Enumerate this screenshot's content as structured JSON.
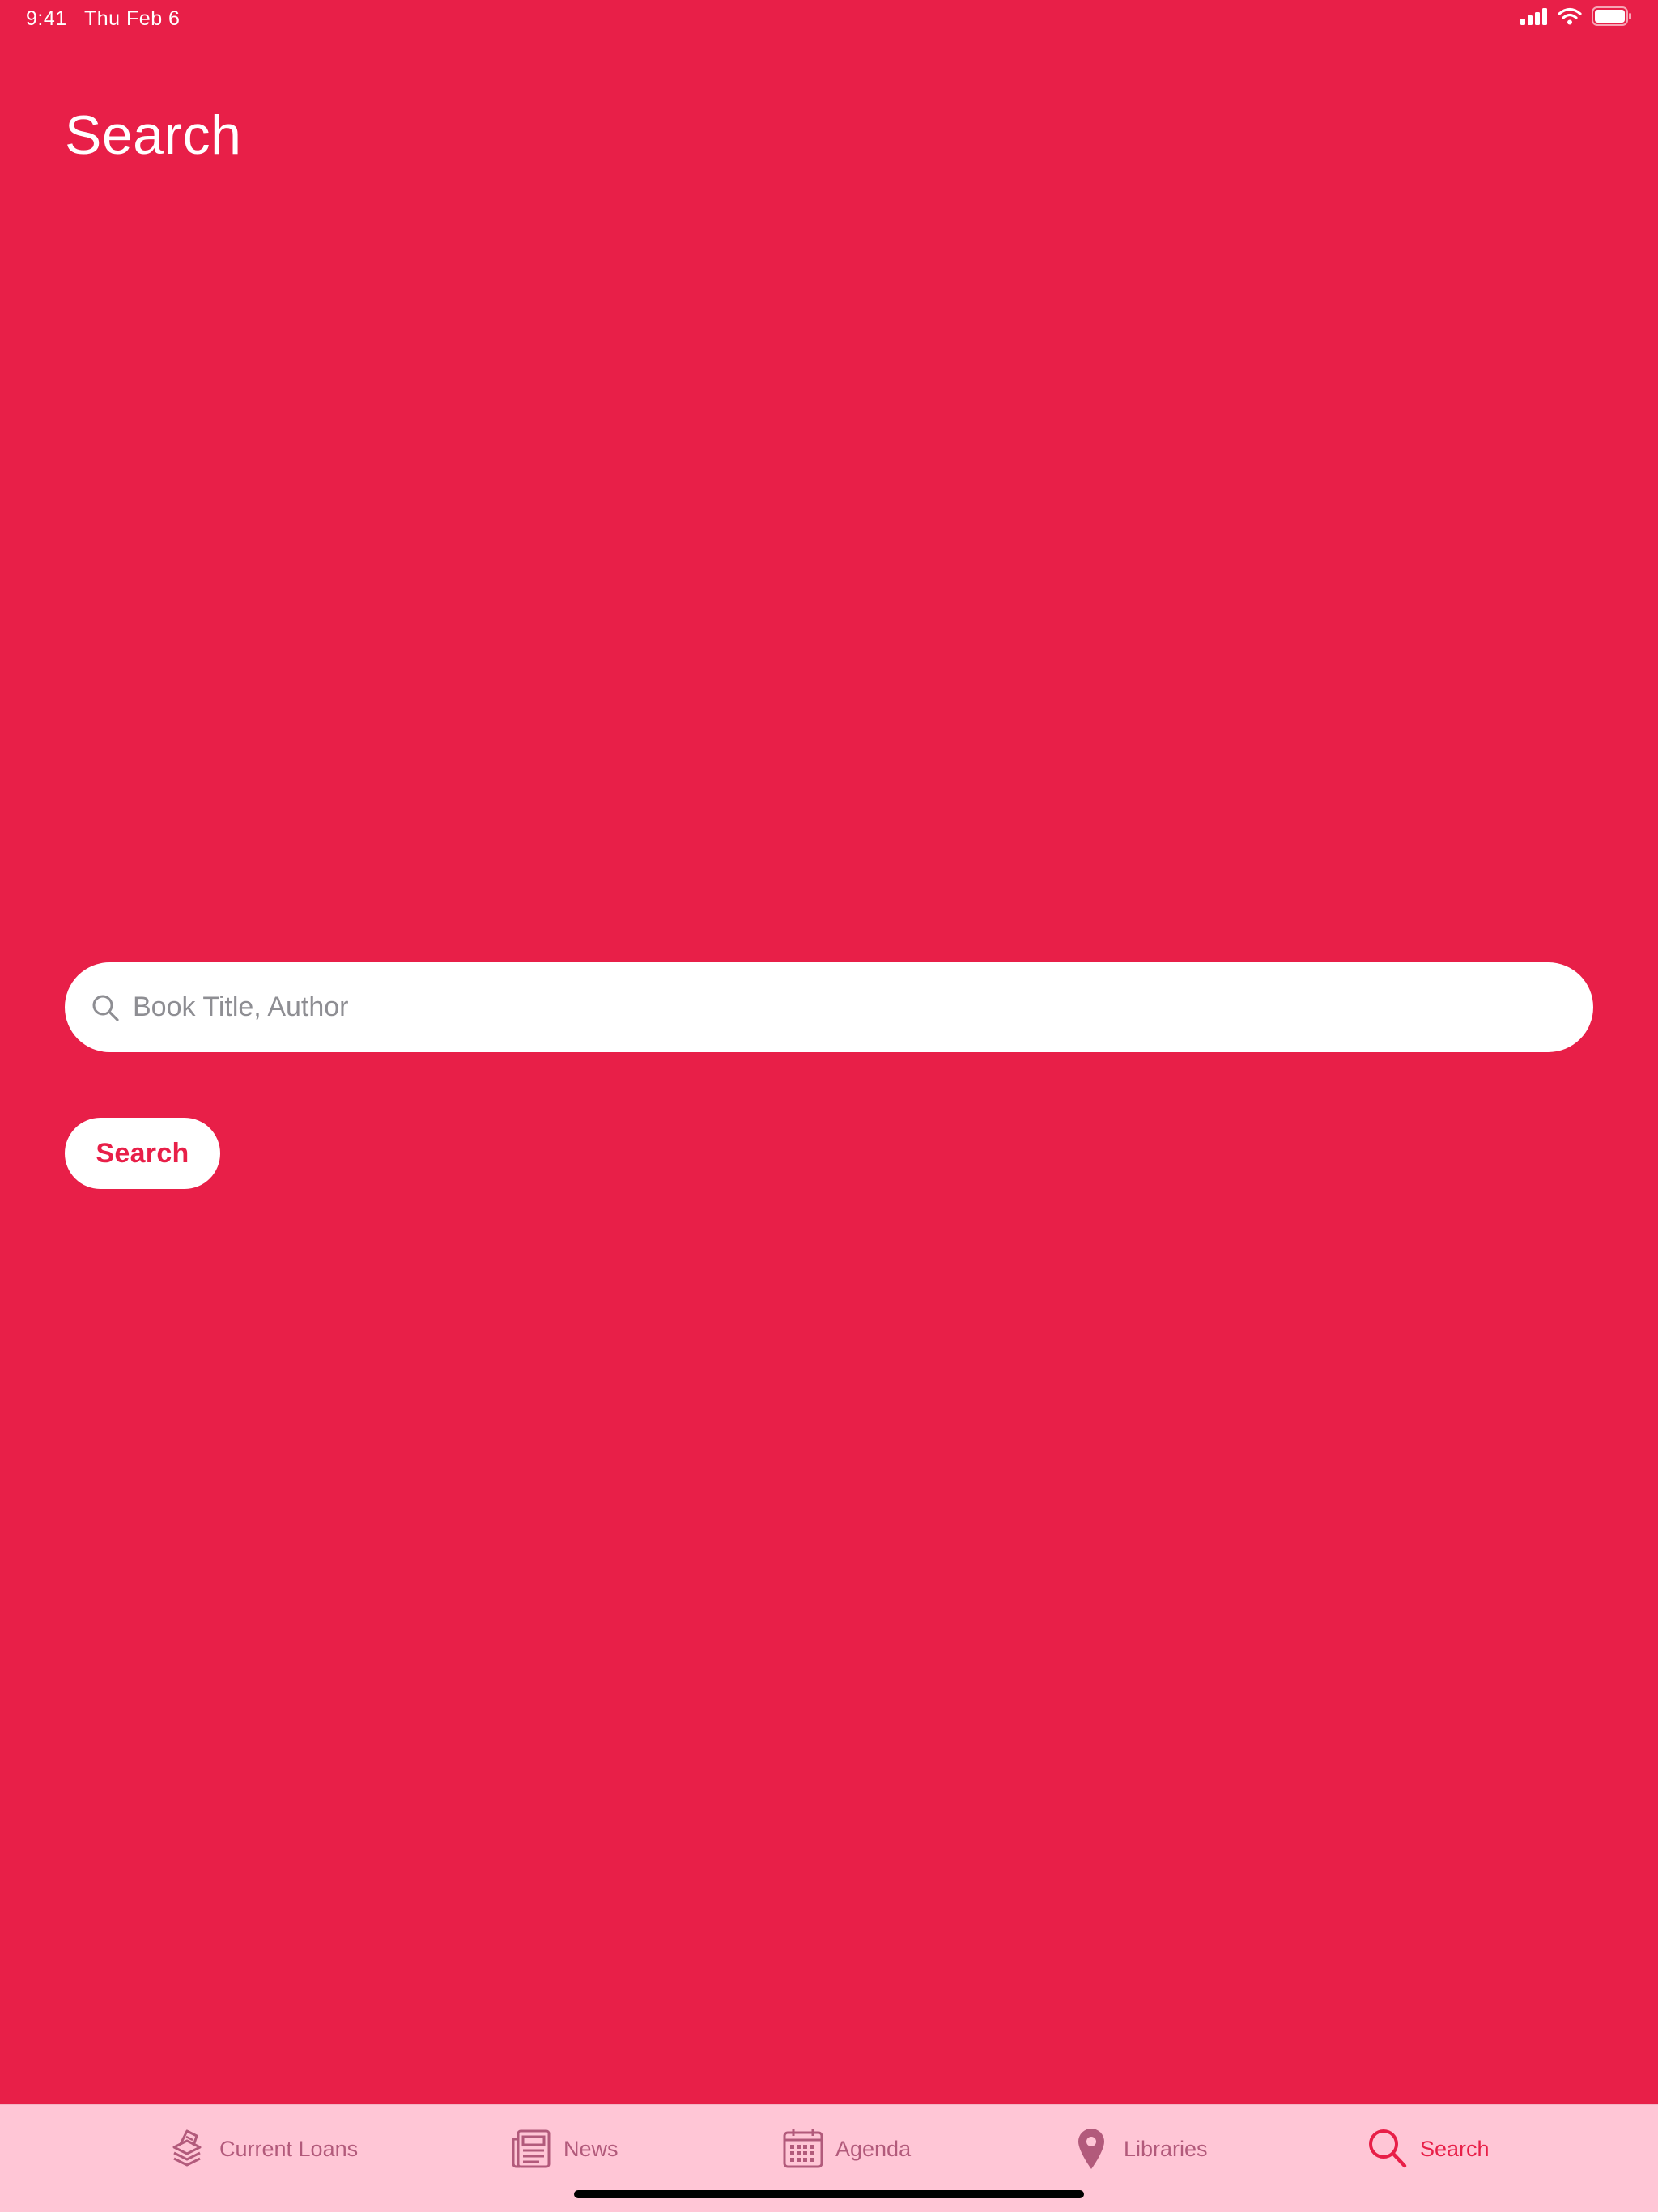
{
  "status_bar": {
    "time": "9:41",
    "date": "Thu Feb 6",
    "icons": [
      "cellular-signal-icon",
      "wifi-icon",
      "battery-icon"
    ]
  },
  "page": {
    "title": "Search"
  },
  "search": {
    "placeholder": "Book Title, Author",
    "value": "",
    "button_label": "Search"
  },
  "tab_bar": {
    "items": [
      {
        "label": "Current Loans",
        "icon": "books-stack-icon",
        "active": false
      },
      {
        "label": "News",
        "icon": "newspaper-icon",
        "active": false
      },
      {
        "label": "Agenda",
        "icon": "calendar-icon",
        "active": false
      },
      {
        "label": "Libraries",
        "icon": "map-pin-icon",
        "active": false
      },
      {
        "label": "Search",
        "icon": "search-icon",
        "active": true
      }
    ]
  },
  "colors": {
    "background": "#E81F48",
    "tab_bar_background": "#FFC6D6",
    "tab_inactive": "#B25A7B",
    "tab_active": "#E81F48"
  }
}
